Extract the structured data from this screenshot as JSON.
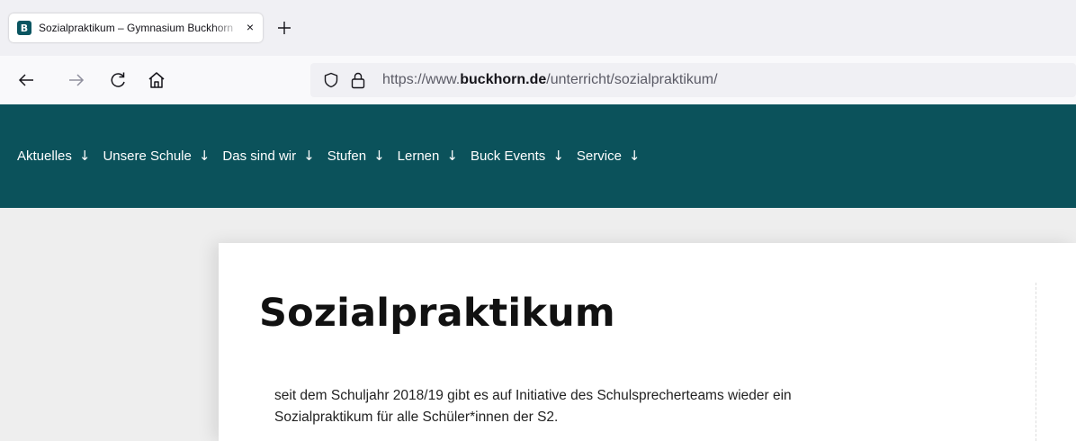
{
  "browser": {
    "tab": {
      "favicon_letter": "B",
      "title": "Sozialpraktikum – Gymnasium Buckhorn",
      "close_glyph": "×"
    },
    "new_tab_icon": "plus-icon",
    "nav_icons": [
      "back-arrow-icon",
      "forward-arrow-icon",
      "reload-icon",
      "home-icon"
    ],
    "url": {
      "prefix": "https://www.",
      "domain": "buckhorn.de",
      "path": "/unterricht/sozialpraktikum/"
    }
  },
  "site": {
    "header_color": "#0b525b",
    "menu": [
      {
        "label": "Aktuelles",
        "arrow": "↓"
      },
      {
        "label": "Unsere Schule",
        "arrow": "↓"
      },
      {
        "label": "Das sind wir",
        "arrow": "↓"
      },
      {
        "label": "Stufen",
        "arrow": "↓"
      },
      {
        "label": "Lernen",
        "arrow": "↓"
      },
      {
        "label": "Buck Events",
        "arrow": "↓"
      },
      {
        "label": "Service",
        "arrow": "↓"
      }
    ]
  },
  "main": {
    "title": "Sozialpraktikum",
    "intro_line1": "seit dem Schuljahr 2018/19 gibt es auf Initiative des Schulsprecherteams wieder ein",
    "intro_line2": "Sozialpraktikum für alle Schüler*innen der S2."
  }
}
